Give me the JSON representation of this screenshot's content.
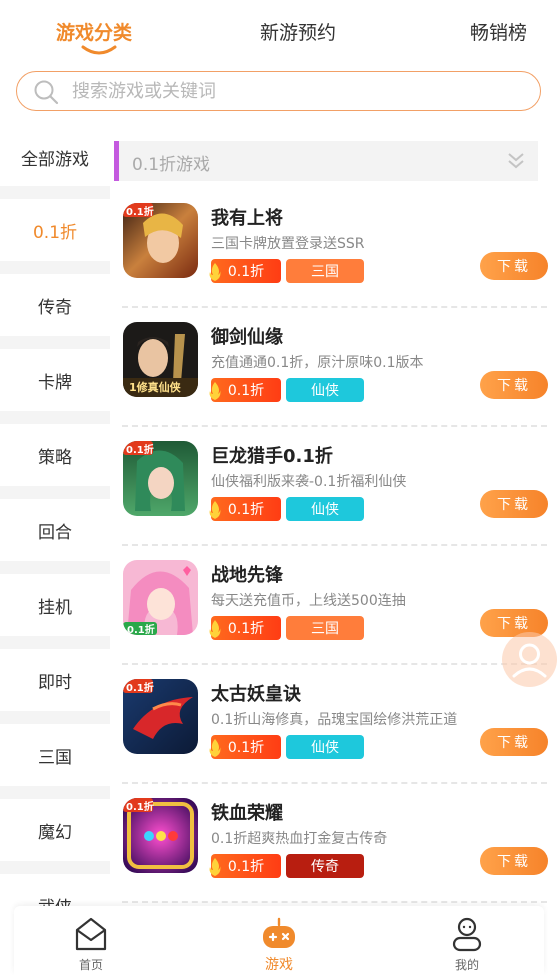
{
  "top_tabs": [
    {
      "label": "游戏分类",
      "active": true
    },
    {
      "label": "新游预约",
      "active": false
    },
    {
      "label": "畅销榜",
      "active": false
    }
  ],
  "search": {
    "placeholder": "搜索游戏或关键词",
    "value": ""
  },
  "sidebar": {
    "items": [
      {
        "label": "全部游戏"
      },
      {
        "label": "0.1折",
        "active": true
      },
      {
        "label": "传奇"
      },
      {
        "label": "卡牌"
      },
      {
        "label": "策略"
      },
      {
        "label": "回合"
      },
      {
        "label": "挂机"
      },
      {
        "label": "即时"
      },
      {
        "label": "三国"
      },
      {
        "label": "魔幻"
      },
      {
        "label": "武侠"
      }
    ]
  },
  "section": {
    "title": "0.1折游戏",
    "icon": "double-chevron-down-icon"
  },
  "games": [
    {
      "name": "我有上将",
      "desc": "三国卡牌放置登录送SSR",
      "rate_tag": "0.1折",
      "type_tag": "三国",
      "type_color": "#ff7d3b",
      "download_label": "下载",
      "icon_badge": "0.1折"
    },
    {
      "name": "御剑仙缘",
      "desc": "充值通通0.1折，原汁原味0.1版本",
      "rate_tag": "0.1折",
      "type_tag": "仙侠",
      "type_color": "#1ec8dc",
      "download_label": "下载",
      "icon_badge": "1修真仙侠"
    },
    {
      "name": "巨龙猎手0.1折",
      "desc": "仙侠福利版来袭-0.1折福利仙侠",
      "rate_tag": "0.1折",
      "type_tag": "仙侠",
      "type_color": "#1ec8dc",
      "download_label": "下载",
      "icon_badge": "0.1折"
    },
    {
      "name": "战地先锋",
      "desc": "每天送充值币，上线送500连抽",
      "rate_tag": "0.1折",
      "type_tag": "三国",
      "type_color": "#ff7d3b",
      "download_label": "下载",
      "icon_badge": "0.1折"
    },
    {
      "name": "太古妖皇诀",
      "desc": "0.1折山海修真，品瑰宝国绘修洪荒正道",
      "rate_tag": "0.1折",
      "type_tag": "仙侠",
      "type_color": "#1ec8dc",
      "download_label": "下载",
      "icon_badge": "0.1折"
    },
    {
      "name": "铁血荣耀",
      "desc": "0.1折超爽热血打金复古传奇",
      "rate_tag": "0.1折",
      "type_tag": "传奇",
      "type_color": "#b81e10",
      "download_label": "下载",
      "icon_badge": "0.1折"
    }
  ],
  "bottom_nav": [
    {
      "label": "首页",
      "icon": "home-icon",
      "active": false
    },
    {
      "label": "游戏",
      "icon": "gamepad-icon",
      "active": true
    },
    {
      "label": "我的",
      "icon": "user-icon",
      "active": false
    }
  ],
  "colors": {
    "accent": "#f08a2c",
    "section_bar": "#c45adf"
  }
}
